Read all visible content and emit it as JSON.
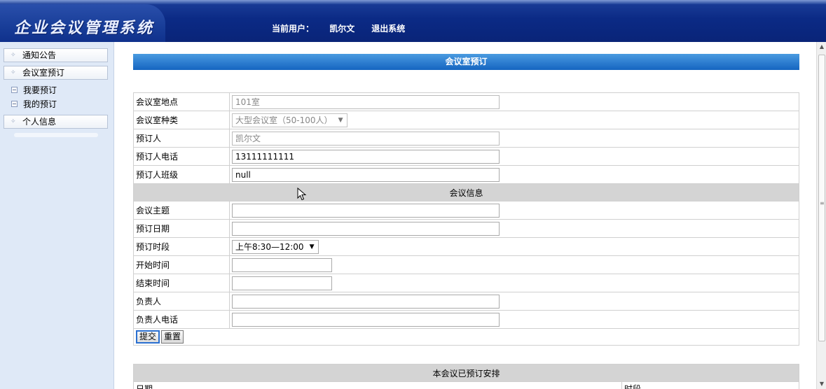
{
  "header": {
    "logo": "企业会议管理系统",
    "current_user_label": "当前用户：",
    "user_name": "凯尔文",
    "logout": "退出系统"
  },
  "sidebar": {
    "items": [
      {
        "label": "通知公告"
      },
      {
        "label": "会议室预订"
      },
      {
        "label": "个人信息"
      }
    ],
    "subitems": [
      {
        "label": "我要预订"
      },
      {
        "label": "我的预订"
      }
    ]
  },
  "main": {
    "title": "会议室预订",
    "room_location": {
      "label": "会议室地点",
      "value": "101室"
    },
    "room_type": {
      "label": "会议室种类",
      "value": "大型会议室（50-100人）"
    },
    "booker": {
      "label": "预订人",
      "value": "凯尔文"
    },
    "booker_phone": {
      "label": "预订人电话",
      "value": "13111111111"
    },
    "booker_class": {
      "label": "预订人班级",
      "value": "null"
    },
    "section_meeting": "会议信息",
    "topic": {
      "label": "会议主题",
      "value": ""
    },
    "date": {
      "label": "预订日期",
      "value": ""
    },
    "time_slot": {
      "label": "预订时段",
      "value": "上午8:30—12:00"
    },
    "start_time": {
      "label": "开始时间",
      "value": ""
    },
    "end_time": {
      "label": "结束时间",
      "value": ""
    },
    "manager": {
      "label": "负责人",
      "value": ""
    },
    "manager_phone": {
      "label": "负责人电话",
      "value": ""
    },
    "submit": "提交",
    "reset": "重置"
  },
  "schedule": {
    "title": "本会议已预订安排",
    "col_date": "日期",
    "col_slot": "时段"
  }
}
